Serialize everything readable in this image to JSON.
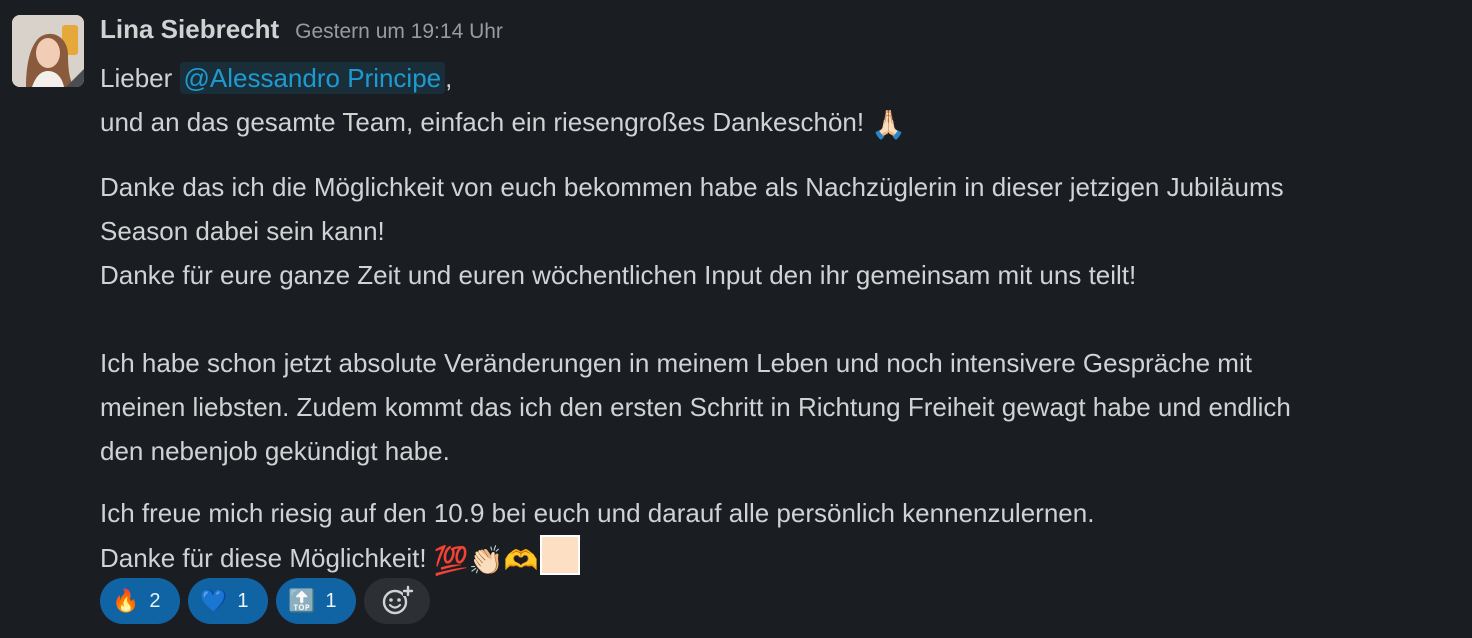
{
  "message": {
    "author": "Lina Siebrecht",
    "timestamp": "Gestern um 19:14 Uhr",
    "greeting_prefix": "Lieber ",
    "mention": "@Alessandro Principe",
    "greeting_suffix": ",",
    "line2_text": "und an das gesamte Team, einfach ein riesengroßes Dankeschön! ",
    "line2_emoji": "🙏🏻",
    "paragraph2_line1": "Danke das ich die Möglichkeit von euch bekommen habe als Nachzüglerin in dieser jetzigen Jubiläums",
    "paragraph2_line2": "Season dabei sein kann!",
    "paragraph2_line3": "Danke für eure ganze Zeit und euren wöchentlichen Input den ihr gemeinsam mit uns teilt!",
    "paragraph3_line1": "Ich habe schon jetzt absolute Veränderungen in meinem Leben und noch intensivere Gespräche mit",
    "paragraph3_line2": "meinen liebsten. Zudem kommt das ich den ersten Schritt in Richtung Freiheit gewagt habe und endlich",
    "paragraph3_line3": "den nebenjob gekündigt habe.",
    "paragraph4_line1": "Ich freue mich riesig auf den 10.9 bei euch und darauf alle persönlich kennenzulernen.",
    "paragraph4_line2_text": "Danke für diese Möglichkeit! ",
    "paragraph4_emojis": "💯👏🏻🫶"
  },
  "reactions": [
    {
      "emoji": "🔥",
      "count": "2"
    },
    {
      "emoji": "💙",
      "count": "1"
    },
    {
      "emoji": "🔝",
      "count": "1"
    }
  ],
  "add_reaction_icon": "add-reaction-icon",
  "colors": {
    "background": "#1a1d21",
    "mention": "#1d9bd1",
    "reaction_bg": "#1164a3",
    "text": "#d1d2d3"
  }
}
